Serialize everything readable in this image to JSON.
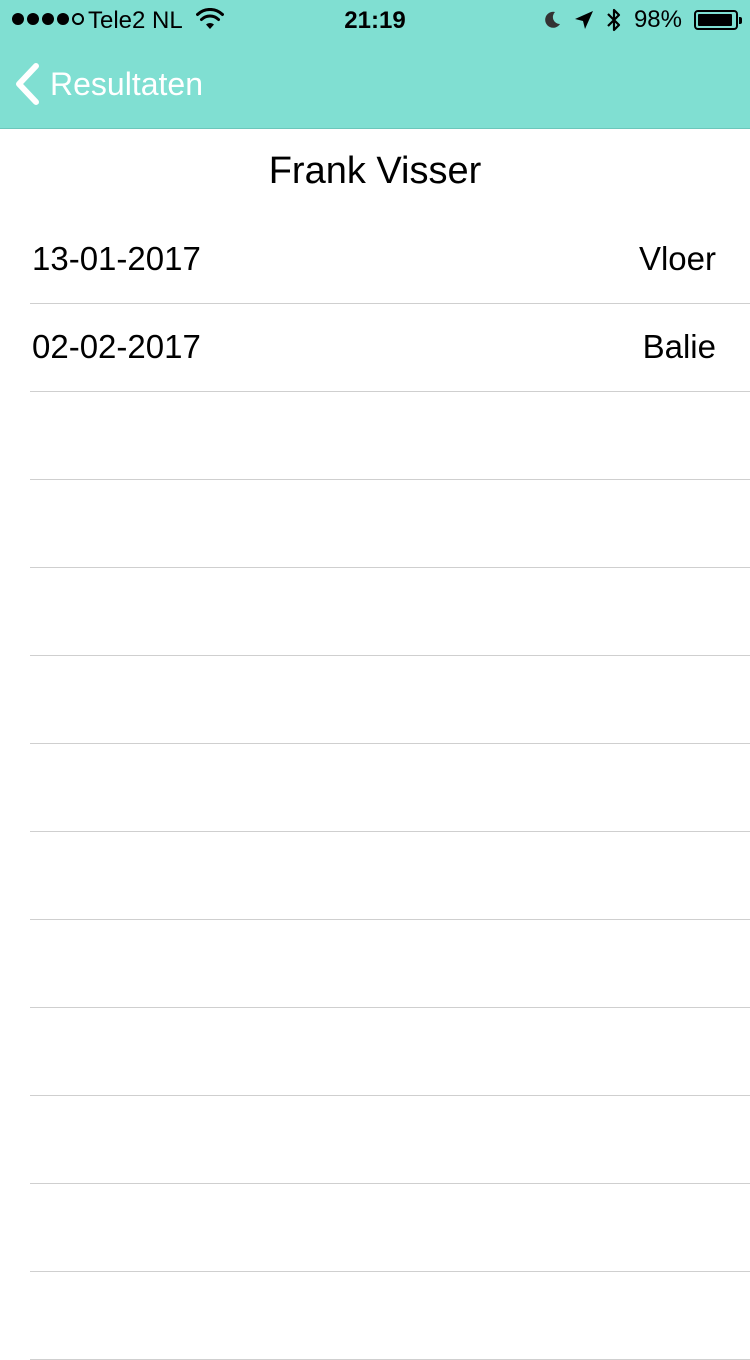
{
  "status_bar": {
    "signal_dots": 5,
    "signal_filled": 4,
    "carrier": "Tele2 NL",
    "time": "21:19",
    "battery_pct": "98%",
    "battery_level": 0.98,
    "icons": [
      "signal-icon",
      "wifi-icon",
      "moon-icon",
      "location-icon",
      "bluetooth-icon",
      "battery-icon"
    ]
  },
  "nav": {
    "back_label": "Resultaten",
    "accent_color": "#80dfd2"
  },
  "page": {
    "title": "Frank Visser"
  },
  "list": {
    "rows": [
      {
        "date": "13-01-2017",
        "value": "Vloer"
      },
      {
        "date": "02-02-2017",
        "value": "Balie"
      },
      {
        "date": "",
        "value": ""
      },
      {
        "date": "",
        "value": ""
      },
      {
        "date": "",
        "value": ""
      },
      {
        "date": "",
        "value": ""
      },
      {
        "date": "",
        "value": ""
      },
      {
        "date": "",
        "value": ""
      },
      {
        "date": "",
        "value": ""
      },
      {
        "date": "",
        "value": ""
      },
      {
        "date": "",
        "value": ""
      },
      {
        "date": "",
        "value": ""
      },
      {
        "date": "",
        "value": ""
      }
    ]
  }
}
